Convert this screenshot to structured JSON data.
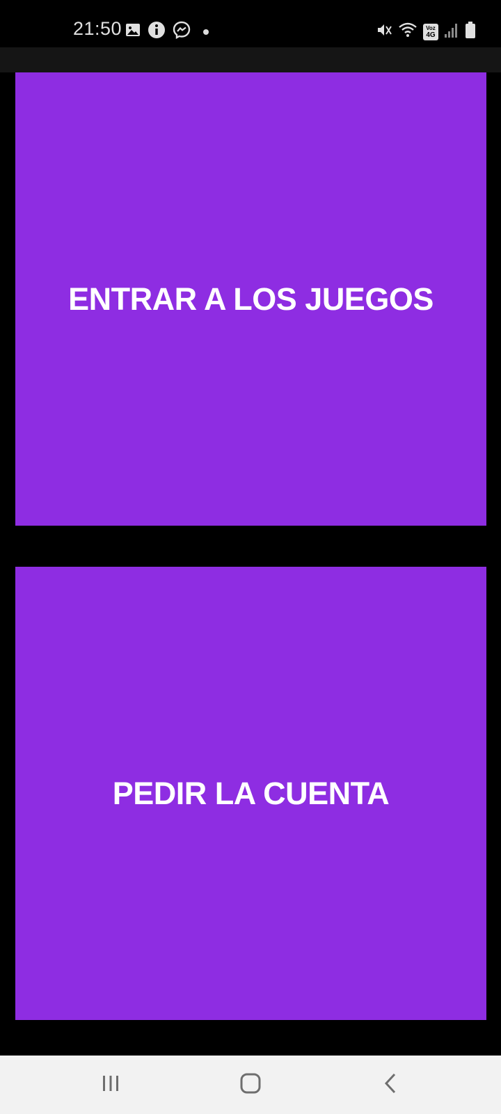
{
  "status_bar": {
    "time": "21:50",
    "left_icons": [
      "gallery-icon",
      "info-icon",
      "messenger-icon",
      "dot-icon"
    ],
    "right_icons": [
      "mute-icon",
      "wifi-icon",
      "volte-4g-icon",
      "signal-icon",
      "battery-icon"
    ],
    "volte_label_top": "Voz",
    "volte_label_bottom": "4G"
  },
  "buttons": {
    "games_label": "ENTRAR A LOS JUEGOS",
    "bill_label": "PEDIR LA CUENTA"
  },
  "colors": {
    "button_background": "#8e2de2",
    "button_text": "#ffffff",
    "screen_background": "#000000",
    "nav_background": "#f2f2f2"
  },
  "nav_bar": {
    "items": [
      "recents-icon",
      "home-icon",
      "back-icon"
    ]
  }
}
